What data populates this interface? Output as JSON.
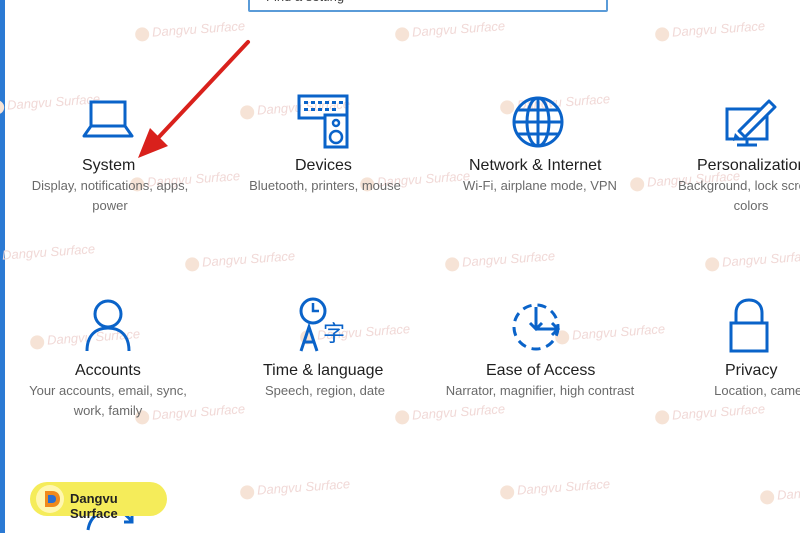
{
  "search": {
    "value": "Find a setting"
  },
  "tiles": [
    {
      "title": "System",
      "desc": "Display, notifications, apps, power",
      "icon": "laptop-icon"
    },
    {
      "title": "Devices",
      "desc": "Bluetooth, printers, mouse",
      "icon": "keyboard-speaker-icon"
    },
    {
      "title": "Network & Internet",
      "desc": "Wi-Fi, airplane mode, VPN",
      "icon": "globe-icon"
    },
    {
      "title": "Personalization",
      "desc": "Background, lock screen, colors",
      "icon": "paint-monitor-icon"
    },
    {
      "title": "Accounts",
      "desc": "Your accounts, email, sync, work, family",
      "icon": "person-icon"
    },
    {
      "title": "Time & language",
      "desc": "Speech, region, date",
      "icon": "clock-language-icon"
    },
    {
      "title": "Ease of Access",
      "desc": "Narrator, magnifier, high contrast",
      "icon": "ease-of-access-icon"
    },
    {
      "title": "Privacy",
      "desc": "Location, camera",
      "icon": "lock-icon"
    }
  ],
  "watermark": "Dangvu Surface",
  "brand": {
    "name": "Dangvu Surface"
  },
  "colors": {
    "accent": "#0a63c9",
    "arrow": "#d9211c",
    "brand_bg": "#f5ec5a"
  }
}
